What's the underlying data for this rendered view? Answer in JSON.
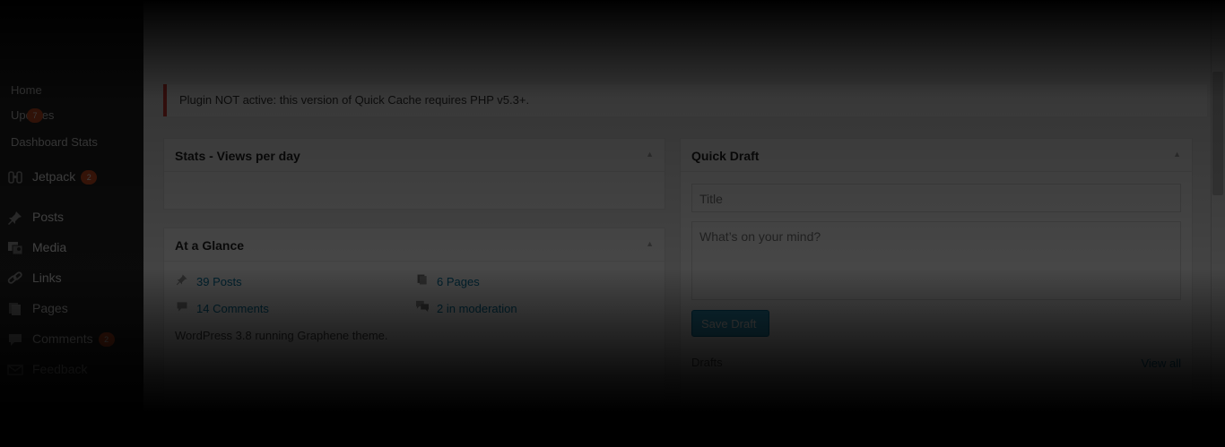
{
  "sidebar": {
    "submenu": [
      {
        "label": "Home"
      },
      {
        "label": "Updates",
        "badge": "7"
      },
      {
        "label": "Dashboard Stats"
      }
    ],
    "items": [
      {
        "label": "Jetpack",
        "icon": "jetpack-icon",
        "badge": "2"
      },
      {
        "label": "Posts",
        "icon": "pin-icon"
      },
      {
        "label": "Media",
        "icon": "media-icon"
      },
      {
        "label": "Links",
        "icon": "link-icon"
      },
      {
        "label": "Pages",
        "icon": "pages-icon"
      },
      {
        "label": "Comments",
        "icon": "comment-icon",
        "badge": "2"
      },
      {
        "label": "Feedback",
        "icon": "feedback-icon"
      }
    ]
  },
  "notice": {
    "text": "Plugin NOT active: this version of Quick Cache requires PHP v5.3+."
  },
  "stats_box": {
    "title": "Stats - Views per day"
  },
  "glance_box": {
    "title": "At a Glance",
    "posts": "39 Posts",
    "pages": "6 Pages",
    "comments": "14 Comments",
    "moderation": "2 in moderation",
    "version_text": "WordPress 3.8 running Graphene theme."
  },
  "quick_draft": {
    "title": "Quick Draft",
    "title_placeholder": "Title",
    "content_placeholder": "What’s on your mind?",
    "save_label": "Save Draft",
    "drafts_label": "Drafts",
    "view_all": "View all"
  },
  "colors": {
    "sidebar_bg": "#222222",
    "accent": "#0074a2",
    "button": "#2ea2cc",
    "badge": "#d54e21",
    "notice_border": "#dd3d36"
  }
}
